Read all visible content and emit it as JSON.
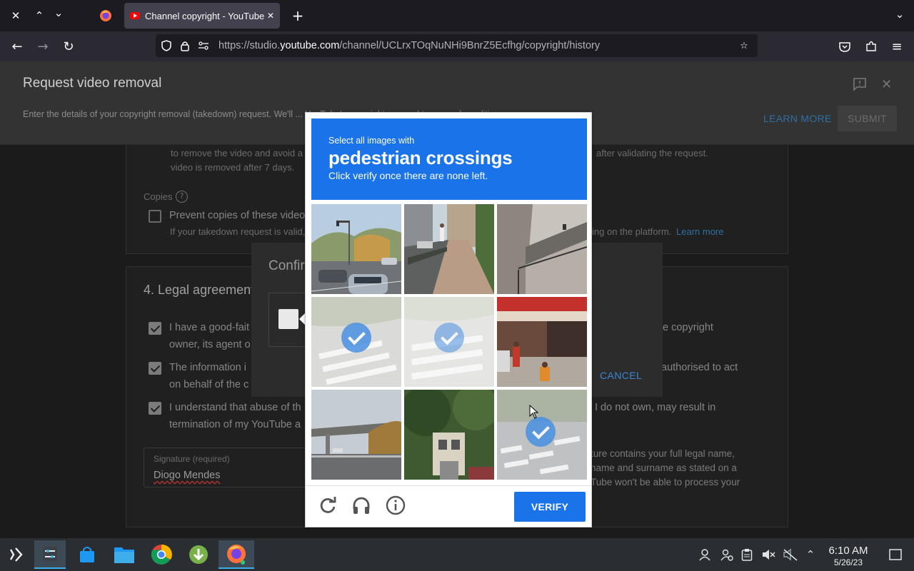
{
  "browser": {
    "tab_title": "Channel copyright - YouTube",
    "url_prefix": "https://studio.",
    "url_domain": "youtube.com",
    "url_path": "/channel/UCLrxTOqNuNHi9BnrZ5Ecfhg/copyright/history"
  },
  "header": {
    "title": "Request video removal",
    "description": "Enter the details of your copyright removal (takedown) request. We'll ... YouTube's copyright removal terms and conditions.",
    "learn_more": "LEARN MORE",
    "submit": "SUBMIT"
  },
  "form": {
    "partial_line1": "to remove the video and avoid a c",
    "partial_line1_right": "after validating the request.",
    "partial_line2": "video is removed after 7 days.",
    "copies_label": "Copies",
    "prevent_copies": "Prevent copies of these video",
    "prevent_copies_note": "If your takedown request is valid,",
    "prevent_copies_note_right": "ing on the platform.",
    "prevent_copies_link": "Learn more",
    "legal_title": "4. Legal agreement",
    "legal_1a": "I have a good-fait",
    "legal_1b": "e copyright",
    "legal_1c": "owner, its agent o",
    "legal_2a": "The information i",
    "legal_2b": "authorised to act",
    "legal_2c": "on behalf of the c",
    "legal_3a": "I understand that abuse of th",
    "legal_3b": "I do not own, may result in",
    "legal_3c": "termination of my YouTube a",
    "signature_label": "Signature (required)",
    "signature_value": "Diogo Mendes",
    "sig_note_1": "ture contains your full legal name,",
    "sig_note_2": "name and surname as stated on a",
    "sig_note_3": "Tube won't be able to process your"
  },
  "confirm_dialog": {
    "title": "Confir",
    "cancel": "CANCEL"
  },
  "challenge": {
    "pre": "Select all images with",
    "target": "pedestrian crossings",
    "post": "Click verify once there are none left.",
    "verify": "VERIFY",
    "tiles": [
      {
        "scene": "road-street",
        "selected": false
      },
      {
        "scene": "sidewalk",
        "selected": false
      },
      {
        "scene": "building-balcony",
        "selected": false
      },
      {
        "scene": "crosswalk-faded",
        "selected": true
      },
      {
        "scene": "crosswalk-faded",
        "selected": true
      },
      {
        "scene": "storefront",
        "selected": false
      },
      {
        "scene": "overpass",
        "selected": false
      },
      {
        "scene": "trees-house",
        "selected": false
      },
      {
        "scene": "crosswalk",
        "selected": true
      }
    ]
  },
  "taskbar": {
    "time": "6:10 AM",
    "date": "5/26/23"
  }
}
